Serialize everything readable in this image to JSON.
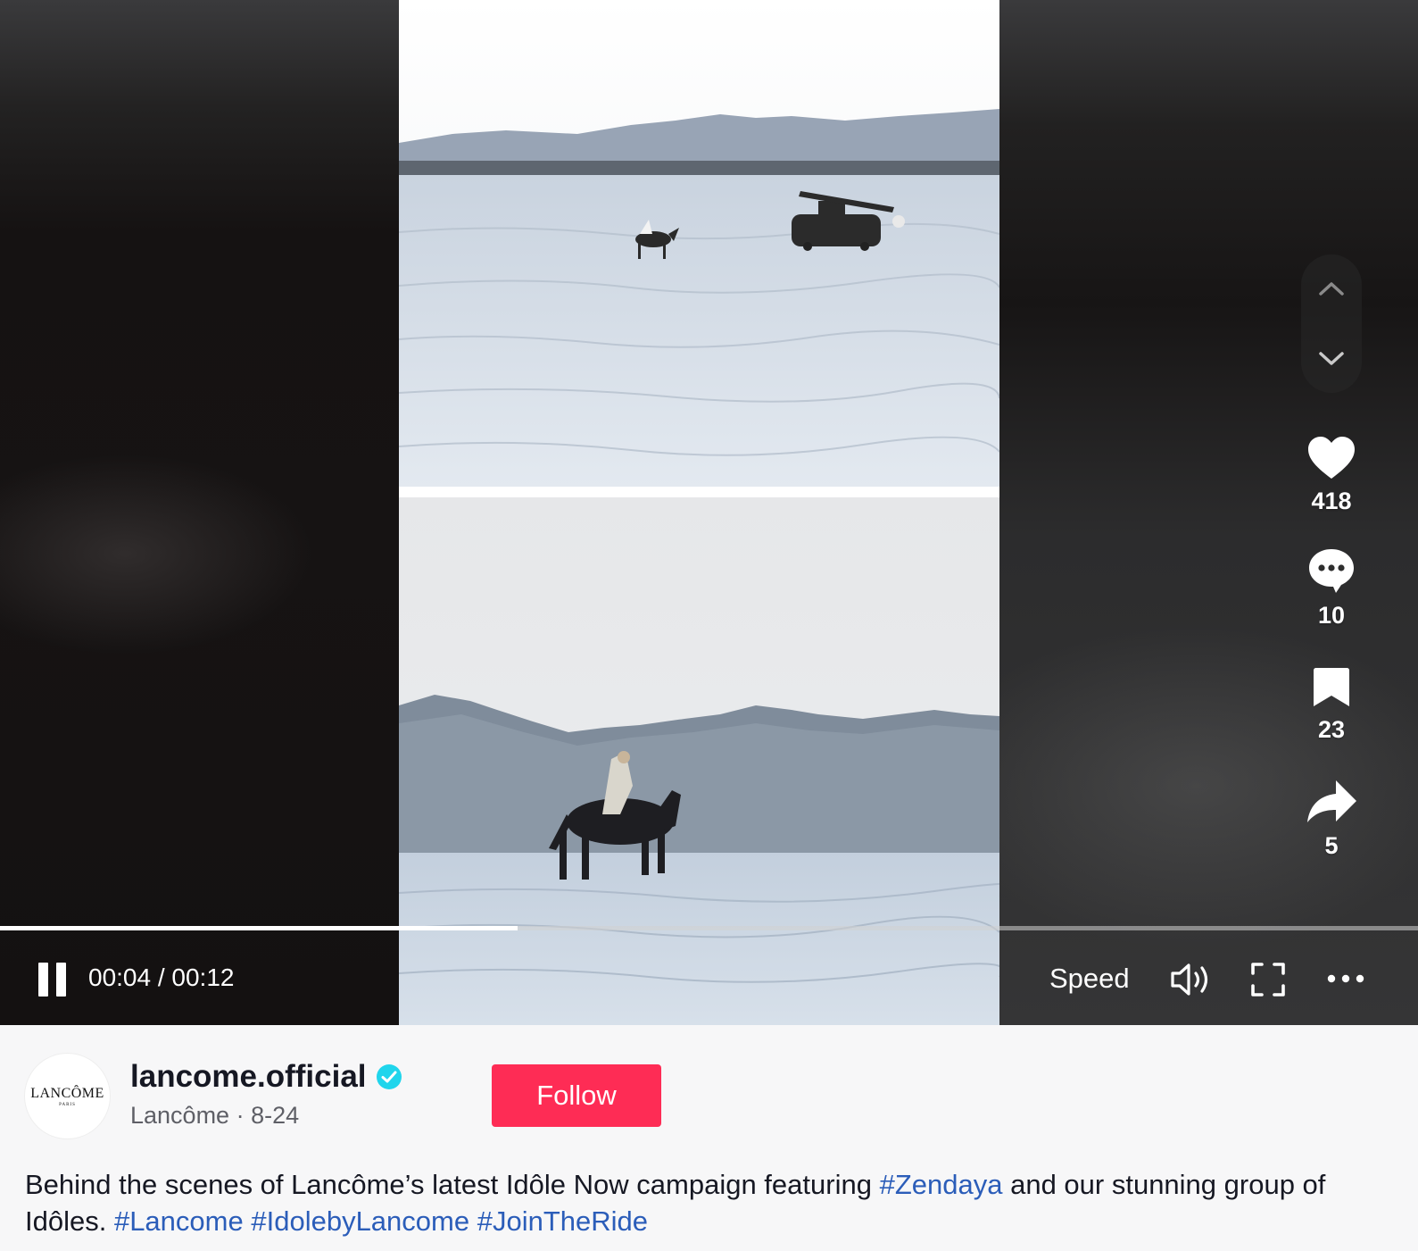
{
  "player": {
    "time_display": "00:04 / 00:12",
    "progress_fraction": 0.365,
    "speed_label": "Speed",
    "is_playing": true
  },
  "actions": {
    "likes": "418",
    "comments": "10",
    "saves": "23",
    "shares": "5"
  },
  "icons": {
    "nav_up": "chevron-up-icon",
    "nav_down": "chevron-down-icon",
    "like": "heart-icon",
    "comment": "comment-bubble-icon",
    "save": "bookmark-icon",
    "share": "share-arrow-icon",
    "pause": "pause-icon",
    "volume": "volume-icon",
    "fullscreen": "fullscreen-icon",
    "more": "more-icon",
    "verified": "verified-badge-icon"
  },
  "author": {
    "avatar_text": "LANCÔME",
    "avatar_subtext": "PARIS",
    "username": "lancome.official",
    "display_name": "Lancôme",
    "separator": " · ",
    "date": "8-24",
    "follow_label": "Follow"
  },
  "caption": {
    "text_1": "Behind the scenes of Lancôme’s latest Idôle Now campaign featuring ",
    "tag_1": "#Zendaya",
    "text_2": " and our stunning group of Idôles. ",
    "tag_2": "#Lancome",
    "tag_3": "#IdolebyLancome",
    "tag_4": "#JoinTheRide"
  },
  "colors": {
    "follow_bg": "#fe2c55",
    "hashtag": "#2b5db9",
    "verified": "#20d5ec"
  }
}
